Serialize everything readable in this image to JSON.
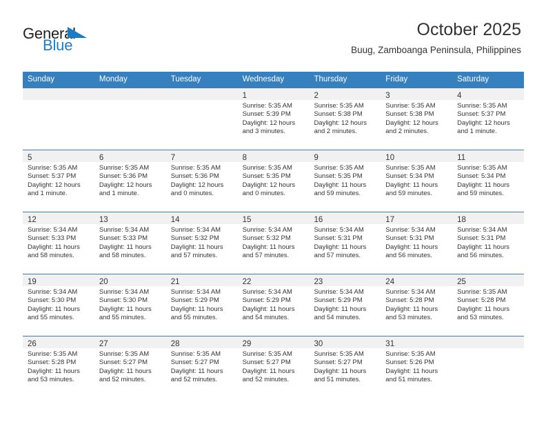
{
  "brand": {
    "name_top": "General",
    "name_bottom": "Blue",
    "accent_color": "#1b7dc4"
  },
  "header": {
    "title": "October 2025",
    "subtitle": "Buug, Zamboanga Peninsula, Philippines"
  },
  "theme": {
    "header_row_color": "#3680c0",
    "day_band_color": "#f1f1f1",
    "text_color": "#333333"
  },
  "weekdays": [
    "Sunday",
    "Monday",
    "Tuesday",
    "Wednesday",
    "Thursday",
    "Friday",
    "Saturday"
  ],
  "weeks": [
    [
      {
        "day": "",
        "sunrise": "",
        "sunset": "",
        "daylight_1": "",
        "daylight_2": ""
      },
      {
        "day": "",
        "sunrise": "",
        "sunset": "",
        "daylight_1": "",
        "daylight_2": ""
      },
      {
        "day": "",
        "sunrise": "",
        "sunset": "",
        "daylight_1": "",
        "daylight_2": ""
      },
      {
        "day": "1",
        "sunrise": "Sunrise: 5:35 AM",
        "sunset": "Sunset: 5:39 PM",
        "daylight_1": "Daylight: 12 hours",
        "daylight_2": "and 3 minutes."
      },
      {
        "day": "2",
        "sunrise": "Sunrise: 5:35 AM",
        "sunset": "Sunset: 5:38 PM",
        "daylight_1": "Daylight: 12 hours",
        "daylight_2": "and 2 minutes."
      },
      {
        "day": "3",
        "sunrise": "Sunrise: 5:35 AM",
        "sunset": "Sunset: 5:38 PM",
        "daylight_1": "Daylight: 12 hours",
        "daylight_2": "and 2 minutes."
      },
      {
        "day": "4",
        "sunrise": "Sunrise: 5:35 AM",
        "sunset": "Sunset: 5:37 PM",
        "daylight_1": "Daylight: 12 hours",
        "daylight_2": "and 1 minute."
      }
    ],
    [
      {
        "day": "5",
        "sunrise": "Sunrise: 5:35 AM",
        "sunset": "Sunset: 5:37 PM",
        "daylight_1": "Daylight: 12 hours",
        "daylight_2": "and 1 minute."
      },
      {
        "day": "6",
        "sunrise": "Sunrise: 5:35 AM",
        "sunset": "Sunset: 5:36 PM",
        "daylight_1": "Daylight: 12 hours",
        "daylight_2": "and 1 minute."
      },
      {
        "day": "7",
        "sunrise": "Sunrise: 5:35 AM",
        "sunset": "Sunset: 5:36 PM",
        "daylight_1": "Daylight: 12 hours",
        "daylight_2": "and 0 minutes."
      },
      {
        "day": "8",
        "sunrise": "Sunrise: 5:35 AM",
        "sunset": "Sunset: 5:35 PM",
        "daylight_1": "Daylight: 12 hours",
        "daylight_2": "and 0 minutes."
      },
      {
        "day": "9",
        "sunrise": "Sunrise: 5:35 AM",
        "sunset": "Sunset: 5:35 PM",
        "daylight_1": "Daylight: 11 hours",
        "daylight_2": "and 59 minutes."
      },
      {
        "day": "10",
        "sunrise": "Sunrise: 5:35 AM",
        "sunset": "Sunset: 5:34 PM",
        "daylight_1": "Daylight: 11 hours",
        "daylight_2": "and 59 minutes."
      },
      {
        "day": "11",
        "sunrise": "Sunrise: 5:35 AM",
        "sunset": "Sunset: 5:34 PM",
        "daylight_1": "Daylight: 11 hours",
        "daylight_2": "and 59 minutes."
      }
    ],
    [
      {
        "day": "12",
        "sunrise": "Sunrise: 5:34 AM",
        "sunset": "Sunset: 5:33 PM",
        "daylight_1": "Daylight: 11 hours",
        "daylight_2": "and 58 minutes."
      },
      {
        "day": "13",
        "sunrise": "Sunrise: 5:34 AM",
        "sunset": "Sunset: 5:33 PM",
        "daylight_1": "Daylight: 11 hours",
        "daylight_2": "and 58 minutes."
      },
      {
        "day": "14",
        "sunrise": "Sunrise: 5:34 AM",
        "sunset": "Sunset: 5:32 PM",
        "daylight_1": "Daylight: 11 hours",
        "daylight_2": "and 57 minutes."
      },
      {
        "day": "15",
        "sunrise": "Sunrise: 5:34 AM",
        "sunset": "Sunset: 5:32 PM",
        "daylight_1": "Daylight: 11 hours",
        "daylight_2": "and 57 minutes."
      },
      {
        "day": "16",
        "sunrise": "Sunrise: 5:34 AM",
        "sunset": "Sunset: 5:31 PM",
        "daylight_1": "Daylight: 11 hours",
        "daylight_2": "and 57 minutes."
      },
      {
        "day": "17",
        "sunrise": "Sunrise: 5:34 AM",
        "sunset": "Sunset: 5:31 PM",
        "daylight_1": "Daylight: 11 hours",
        "daylight_2": "and 56 minutes."
      },
      {
        "day": "18",
        "sunrise": "Sunrise: 5:34 AM",
        "sunset": "Sunset: 5:31 PM",
        "daylight_1": "Daylight: 11 hours",
        "daylight_2": "and 56 minutes."
      }
    ],
    [
      {
        "day": "19",
        "sunrise": "Sunrise: 5:34 AM",
        "sunset": "Sunset: 5:30 PM",
        "daylight_1": "Daylight: 11 hours",
        "daylight_2": "and 55 minutes."
      },
      {
        "day": "20",
        "sunrise": "Sunrise: 5:34 AM",
        "sunset": "Sunset: 5:30 PM",
        "daylight_1": "Daylight: 11 hours",
        "daylight_2": "and 55 minutes."
      },
      {
        "day": "21",
        "sunrise": "Sunrise: 5:34 AM",
        "sunset": "Sunset: 5:29 PM",
        "daylight_1": "Daylight: 11 hours",
        "daylight_2": "and 55 minutes."
      },
      {
        "day": "22",
        "sunrise": "Sunrise: 5:34 AM",
        "sunset": "Sunset: 5:29 PM",
        "daylight_1": "Daylight: 11 hours",
        "daylight_2": "and 54 minutes."
      },
      {
        "day": "23",
        "sunrise": "Sunrise: 5:34 AM",
        "sunset": "Sunset: 5:29 PM",
        "daylight_1": "Daylight: 11 hours",
        "daylight_2": "and 54 minutes."
      },
      {
        "day": "24",
        "sunrise": "Sunrise: 5:34 AM",
        "sunset": "Sunset: 5:28 PM",
        "daylight_1": "Daylight: 11 hours",
        "daylight_2": "and 53 minutes."
      },
      {
        "day": "25",
        "sunrise": "Sunrise: 5:35 AM",
        "sunset": "Sunset: 5:28 PM",
        "daylight_1": "Daylight: 11 hours",
        "daylight_2": "and 53 minutes."
      }
    ],
    [
      {
        "day": "26",
        "sunrise": "Sunrise: 5:35 AM",
        "sunset": "Sunset: 5:28 PM",
        "daylight_1": "Daylight: 11 hours",
        "daylight_2": "and 53 minutes."
      },
      {
        "day": "27",
        "sunrise": "Sunrise: 5:35 AM",
        "sunset": "Sunset: 5:27 PM",
        "daylight_1": "Daylight: 11 hours",
        "daylight_2": "and 52 minutes."
      },
      {
        "day": "28",
        "sunrise": "Sunrise: 5:35 AM",
        "sunset": "Sunset: 5:27 PM",
        "daylight_1": "Daylight: 11 hours",
        "daylight_2": "and 52 minutes."
      },
      {
        "day": "29",
        "sunrise": "Sunrise: 5:35 AM",
        "sunset": "Sunset: 5:27 PM",
        "daylight_1": "Daylight: 11 hours",
        "daylight_2": "and 52 minutes."
      },
      {
        "day": "30",
        "sunrise": "Sunrise: 5:35 AM",
        "sunset": "Sunset: 5:27 PM",
        "daylight_1": "Daylight: 11 hours",
        "daylight_2": "and 51 minutes."
      },
      {
        "day": "31",
        "sunrise": "Sunrise: 5:35 AM",
        "sunset": "Sunset: 5:26 PM",
        "daylight_1": "Daylight: 11 hours",
        "daylight_2": "and 51 minutes."
      },
      {
        "day": "",
        "sunrise": "",
        "sunset": "",
        "daylight_1": "",
        "daylight_2": ""
      }
    ]
  ]
}
